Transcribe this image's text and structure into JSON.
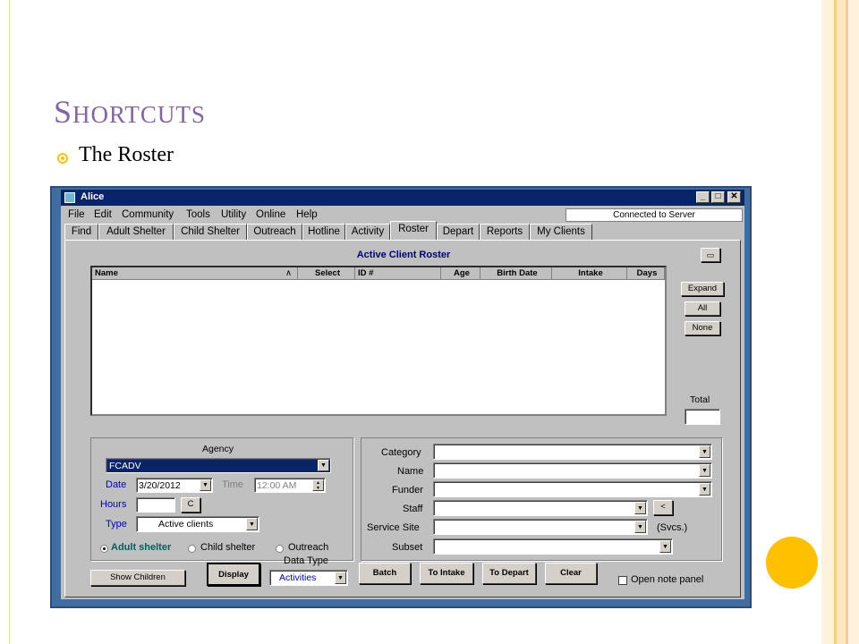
{
  "slide": {
    "title_first": "S",
    "title_rest": "HORTCUTS",
    "bullet": "The Roster"
  },
  "window": {
    "title": "Alice",
    "controls": [
      "_",
      "□",
      "✕"
    ],
    "menu": [
      "File",
      "Edit",
      "Community",
      "Tools",
      "Utility",
      "Online",
      "Help"
    ],
    "status": "Connected to Server",
    "tabs": [
      "Find",
      "Adult Shelter",
      "Child Shelter",
      "Outreach",
      "Hotline",
      "Activity",
      "Roster",
      "Depart",
      "Reports",
      "My Clients"
    ],
    "active_tab": "Roster"
  },
  "roster": {
    "title": "Active Client Roster",
    "columns": [
      "Name",
      "Select",
      "ID #",
      "Age",
      "Birth Date",
      "Intake",
      "Days"
    ],
    "sort_indicator": "∧",
    "rows": [],
    "expand_label": "Expand",
    "all_label": "All",
    "none_label": "None",
    "total_label": "Total",
    "total_value": ""
  },
  "agency_panel": {
    "agency_label": "Agency",
    "agency_value": "FCADV",
    "date_label": "Date",
    "date_value": "3/20/2012",
    "time_label": "Time",
    "time_value": "12:00 AM",
    "hours_label": "Hours",
    "hours_value": "",
    "c_label": "C",
    "type_label": "Type",
    "type_value": "Active clients",
    "radios": [
      {
        "label": "Adult shelter",
        "selected": true
      },
      {
        "label": "Child shelter",
        "selected": false
      },
      {
        "label": "Outreach",
        "selected": false
      }
    ]
  },
  "filter_panel": {
    "category_label": "Category",
    "name_label": "Name",
    "funder_label": "Funder",
    "staff_label": "Staff",
    "staff_btn": "<",
    "service_site_label": "Service Site",
    "svcs_label": "(Svcs.)",
    "subset_label": "Subset"
  },
  "footer": {
    "show_children": "Show Children",
    "display": "Display",
    "data_type_label": "Data Type",
    "data_type_value": "Activities",
    "batch": "Batch",
    "to_intake": "To Intake",
    "to_depart": "To Depart",
    "clear": "Clear",
    "open_note_panel": "Open note panel"
  },
  "colors": {
    "title": "#8364a8",
    "accent": "#ffc000",
    "window_frame": "#3f6ea0",
    "titlebar": "#0a246a",
    "panel": "#c0c0c0",
    "label_blue": "#0000c8",
    "roster_title": "#00007a"
  }
}
